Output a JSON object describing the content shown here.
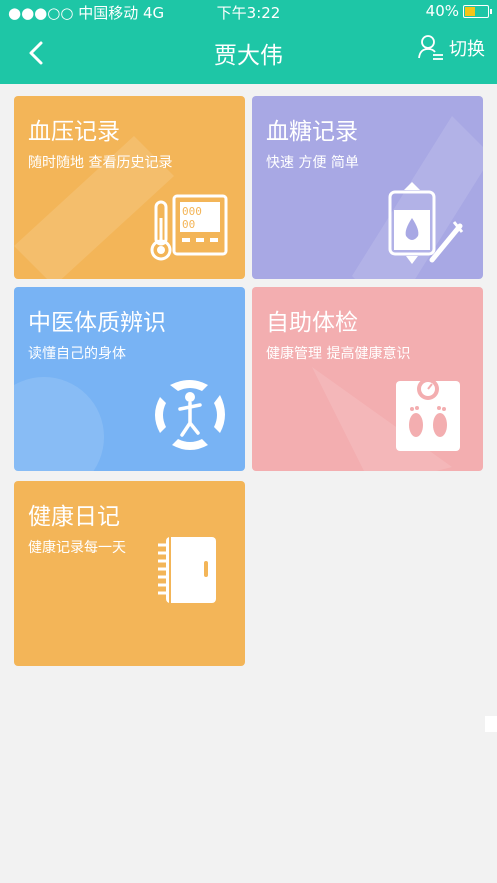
{
  "status_bar": {
    "carrier": "●●●○○ 中国移动  4G",
    "time": "下午3:22",
    "battery": "40%"
  },
  "nav": {
    "title": "贾大伟",
    "switch_label": "切换"
  },
  "cards": [
    {
      "title": "血压记录",
      "subtitle": "随时随地 查看历史记录",
      "color": "#f3b558",
      "icon": "blood-pressure-monitor-icon"
    },
    {
      "title": "血糖记录",
      "subtitle": "快速 方便 简单",
      "color": "#a8a8e4",
      "icon": "blood-sugar-icon"
    },
    {
      "title": "中医体质辨识",
      "subtitle": "读懂自己的身体",
      "color": "#78b3f4",
      "icon": "tcm-body-icon"
    },
    {
      "title": "自助体检",
      "subtitle": "健康管理  提高健康意识",
      "color": "#f3aeb0",
      "icon": "scale-icon"
    },
    {
      "title": "健康日记",
      "subtitle": "健康记录每一天",
      "color": "#f3b558",
      "icon": "notebook-icon"
    }
  ],
  "monitor_readout": {
    "top": "000",
    "bottom": "00"
  }
}
